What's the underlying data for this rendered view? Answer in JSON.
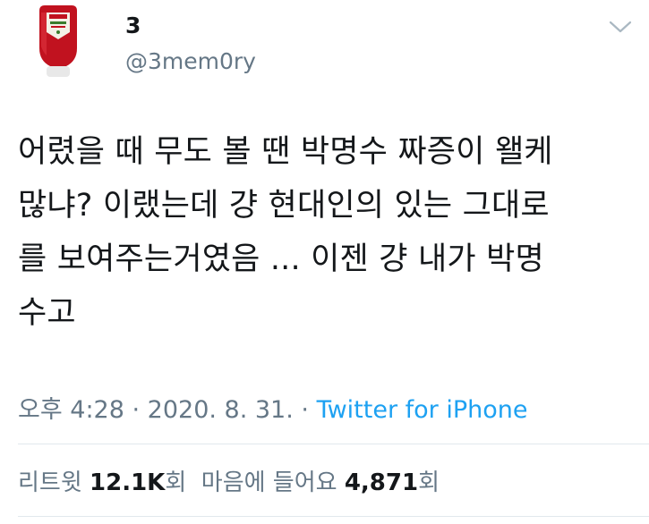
{
  "user": {
    "display_name": "3",
    "handle": "@3mem0ry",
    "avatar_icon": "ketchup-bottle-icon"
  },
  "tweet": {
    "lines": [
      "어렸을 때 무도 볼 땐 박명수 짜증이 왤케",
      "많냐? 이랬는데 걍 현대인의 있는 그대로",
      "를 보여주는거였음 ... 이젠 걍 내가 박명",
      "수고"
    ]
  },
  "meta": {
    "time": "오후 4:28",
    "sep1": " · ",
    "date": "2020. 8. 31.",
    "sep2": " · ",
    "source": "Twitter for iPhone"
  },
  "stats": {
    "retweets_label": "리트윗",
    "retweets_count": "12.1K",
    "retweets_unit": "회",
    "likes_label": "마음에 들어요",
    "likes_count": "4,871",
    "likes_unit": "회"
  },
  "colors": {
    "link": "#1da1f2",
    "secondary_text": "#657786",
    "divider": "#e1e8ed"
  }
}
